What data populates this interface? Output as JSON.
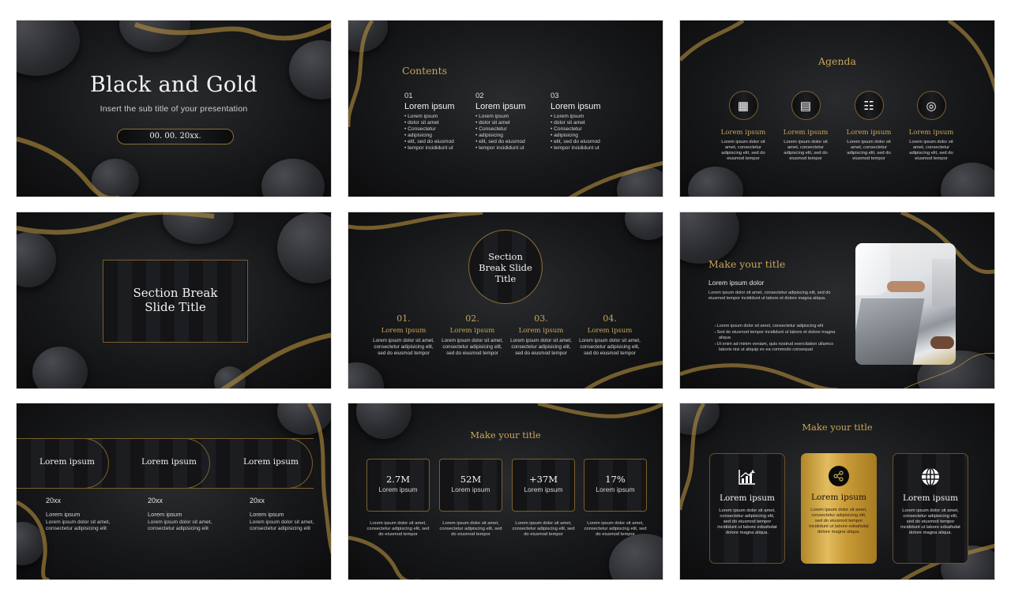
{
  "colors": {
    "gold": "#c9a55a",
    "background": "#17181a",
    "text": "#f2f2f2"
  },
  "slides": {
    "s1": {
      "title": "Black and Gold",
      "subtitle": "Insert the sub title of your presentation",
      "date": "00. 00. 20xx."
    },
    "s2": {
      "heading": "Contents",
      "columns": [
        {
          "number": "01",
          "title": "Lorem ipsum",
          "bullets": [
            "Lorem ipsum",
            "dolor sit amet",
            "Consectetur",
            "adipisicing",
            "elit, sed do eiusmod",
            "tempor incididunt ut"
          ]
        },
        {
          "number": "02",
          "title": "Lorem ipsum",
          "bullets": [
            "Lorem ipsum",
            "dolor sit amet",
            "Consectetur",
            "adipisicing",
            "elit, sed do eiusmod",
            "tempor incididunt ut"
          ]
        },
        {
          "number": "03",
          "title": "Lorem ipsum",
          "bullets": [
            "Lorem ipsum",
            "dolor sit amet",
            "Consectetur",
            "adipisicing",
            "elit, sed do eiusmod",
            "tempor incididunt ut"
          ]
        }
      ]
    },
    "s3": {
      "heading": "Agenda",
      "items": [
        {
          "icon": "calendar-icon",
          "glyph": "▦",
          "title": "Lorem ipsum",
          "desc": "Lorem ipsum dolor sit amet, consectetur adipiscing elit, sed do eiusmod tempor"
        },
        {
          "icon": "document-icon",
          "glyph": "▤",
          "title": "Lorem ipsum",
          "desc": "Lorem ipsum dolor sit amet, consectetur adipiscing elit, sed do eiusmod tempor"
        },
        {
          "icon": "report-icon",
          "glyph": "☷",
          "title": "Lorem ipsum",
          "desc": "Lorem ipsum dolor sit amet, consectetur adipiscing elit, sed do eiusmod tempor"
        },
        {
          "icon": "target-icon",
          "glyph": "◎",
          "title": "Lorem ipsum",
          "desc": "Lorem ipsum dolor sit amet, consectetur adipiscing elit, sed do eiusmod tempor"
        }
      ]
    },
    "s4": {
      "title_line1": "Section Break",
      "title_line2": "Slide Title"
    },
    "s5": {
      "title_line1": "Section",
      "title_line2": "Break Slide",
      "title_line3": "Title",
      "items": [
        {
          "number": "01.",
          "title": "Lorem ipsum",
          "desc": "Lorem ipsum dolor sit amet, consectetur adipisicing elit, sed do eiusmod tempor"
        },
        {
          "number": "02.",
          "title": "Lorem ipsum",
          "desc": "Lorem ipsum dolor sit amet, consectetur adipisicing elit, sed do eiusmod tempor"
        },
        {
          "number": "03.",
          "title": "Lorem ipsum",
          "desc": "Lorem ipsum dolor sit amet, consectetur adipisicing elit, sed do eiusmod tempor"
        },
        {
          "number": "04.",
          "title": "Lorem ipsum",
          "desc": "Lorem ipsum dolor sit amet, consectetur adipisicing elit, sed do eiusmod tempor"
        }
      ]
    },
    "s6": {
      "heading": "Make your title",
      "subheading": "Lorem ipsum dolor",
      "paragraph": "Lorem ipsum dolor sit amet, consectetur adipiscing elit, sed do eiusmod tempor incididunt ut labore et dolore magna aliqua.",
      "bullets": [
        "Lorem ipsum dolor sit amet, consectetur adipiscing elit",
        "Sed do eiusmod tempor incididunt ut labore et dolore magna aliqua",
        "Ut enim ad minim veniam, quis nostrud exercitation ullamco laboris nisi ut aliquip ex ea commodo consequat"
      ],
      "image_alt": "people working on laptops"
    },
    "s7": {
      "pills": [
        "Lorem ipsum",
        "Lorem ipsum",
        "Lorem ipsum"
      ],
      "columns": [
        {
          "year": "20xx",
          "title": "Lorem ipsum",
          "desc": "Lorem ipsum dolor sit amet, consectetur adipisicing elit"
        },
        {
          "year": "20xx",
          "title": "Lorem ipsum",
          "desc": "Lorem ipsum dolor sit amet, consectetur adipisicing elit"
        },
        {
          "year": "20xx",
          "title": "Lorem ipsum",
          "desc": "Lorem ipsum dolor sit amet, consectetur adipisicing elit"
        }
      ]
    },
    "s8": {
      "heading": "Make your title",
      "cards": [
        {
          "value": "2.7M",
          "label": "Lorem ipsum",
          "desc": "Lorem ipsum dolor sit amet, consectetur adipiscing elit, sed do eiusmod tempor"
        },
        {
          "value": "52M",
          "label": "Lorem ipsum",
          "desc": "Lorem ipsum dolor sit amet, consectetur adipiscing elit, sed do eiusmod tempor"
        },
        {
          "value": "+37M",
          "label": "Lorem ipsum",
          "desc": "Lorem ipsum dolor sit amet, consectetur adipiscing elit, sed do eiusmod tempor"
        },
        {
          "value": "17%",
          "label": "Lorem ipsum",
          "desc": "Lorem ipsum dolor sit amet, consectetur adipiscing elit, sed do eiusmod tempor"
        }
      ]
    },
    "s9": {
      "heading": "Make your title",
      "cards": [
        {
          "icon": "growth-chart-icon",
          "glyph": "📈",
          "title": "Lorem ipsum",
          "desc": "Lorem ipsum dolor sit amet, consectetur adipisicing elit, sed do eiusmod tempor incididunt ut labore edsafsdat dolore magna aliqua."
        },
        {
          "icon": "share-icon",
          "glyph": "⋖",
          "title": "Lorem ipsum",
          "desc": "Lorem ipsum dolor sit amet, consectetur adipisicing elit, sed do eiusmod tempor incididunt ut labore edsafsdat dolore magna aliqua."
        },
        {
          "icon": "globe-icon",
          "glyph": "🌐",
          "title": "Lorem ipsum",
          "desc": "Lorem ipsum dolor sit amet, consectetur adipisicing elit, sed do eiusmod tempor incididunt ut labore edsafsdat dolore magna aliqua."
        }
      ]
    }
  }
}
